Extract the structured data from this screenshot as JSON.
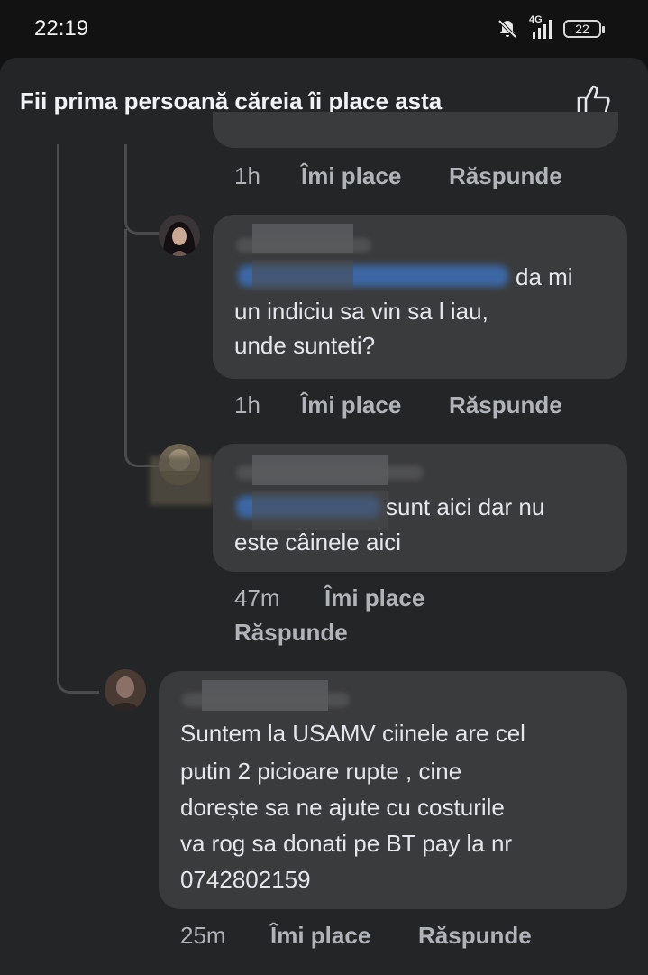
{
  "status_bar": {
    "time": "22:19",
    "network": "4G",
    "battery": "22"
  },
  "header": {
    "title": "Fii prima persoană căreia îi place asta",
    "like_icon": "thumbs-up-icon"
  },
  "actions": {
    "like": "Îmi place",
    "reply": "Răspunde"
  },
  "comments": [
    {
      "time": "1h"
    },
    {
      "text_after_mention": "da mi",
      "text_lines": [
        "un indiciu sa vin sa l iau,",
        "unde sunteti?"
      ],
      "time": "1h"
    },
    {
      "text_after_mention": "sunt aici dar nu",
      "text_lines": [
        "este câinele aici"
      ],
      "time": "47m"
    },
    {
      "text_lines": [
        "Suntem la USAMV ciinele are cel",
        "putin 2 picioare rupte , cine",
        "dorește sa ne ajute cu costurile",
        "va rog sa donati pe BT pay la nr",
        "0742802159"
      ],
      "time": "25m"
    }
  ],
  "colors": {
    "background": "#242526",
    "bubble": "#3a3b3c",
    "mention": "#4e8ef0",
    "meta_text": "#b0b3b8"
  }
}
